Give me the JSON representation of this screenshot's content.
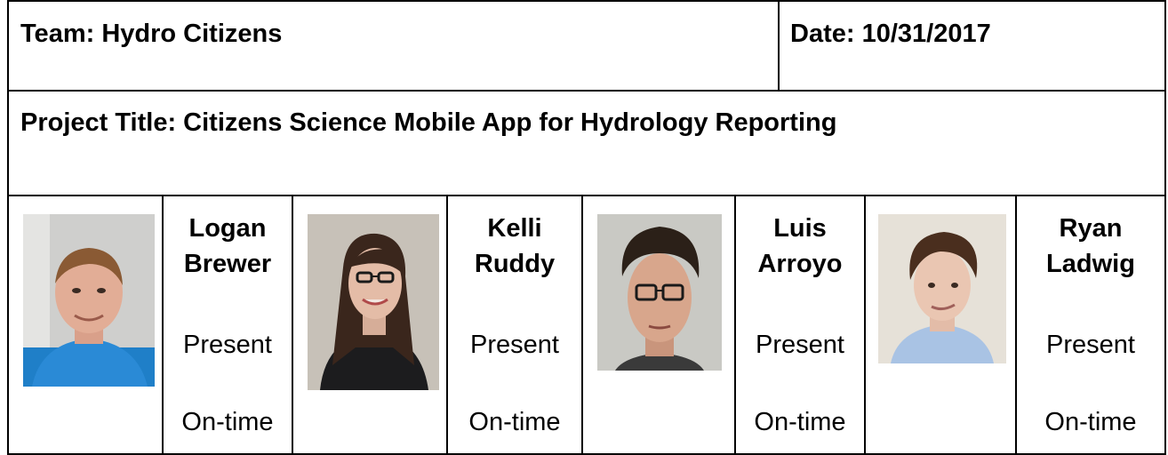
{
  "header": {
    "team": "Team: Hydro Citizens",
    "date": "Date: 10/31/2017"
  },
  "project_title": "Project Title: Citizens Science Mobile App for Hydrology Reporting",
  "members": [
    {
      "first": "Logan",
      "last": "Brewer",
      "attendance": "Present",
      "punctuality": "On-time"
    },
    {
      "first": "Kelli",
      "last": "Ruddy",
      "attendance": "Present",
      "punctuality": "On-time"
    },
    {
      "first": "Luis",
      "last": "Arroyo",
      "attendance": "Present",
      "punctuality": "On-time"
    },
    {
      "first": "Ryan",
      "last": "Ladwig",
      "attendance": "Present",
      "punctuality": "On-time"
    }
  ]
}
